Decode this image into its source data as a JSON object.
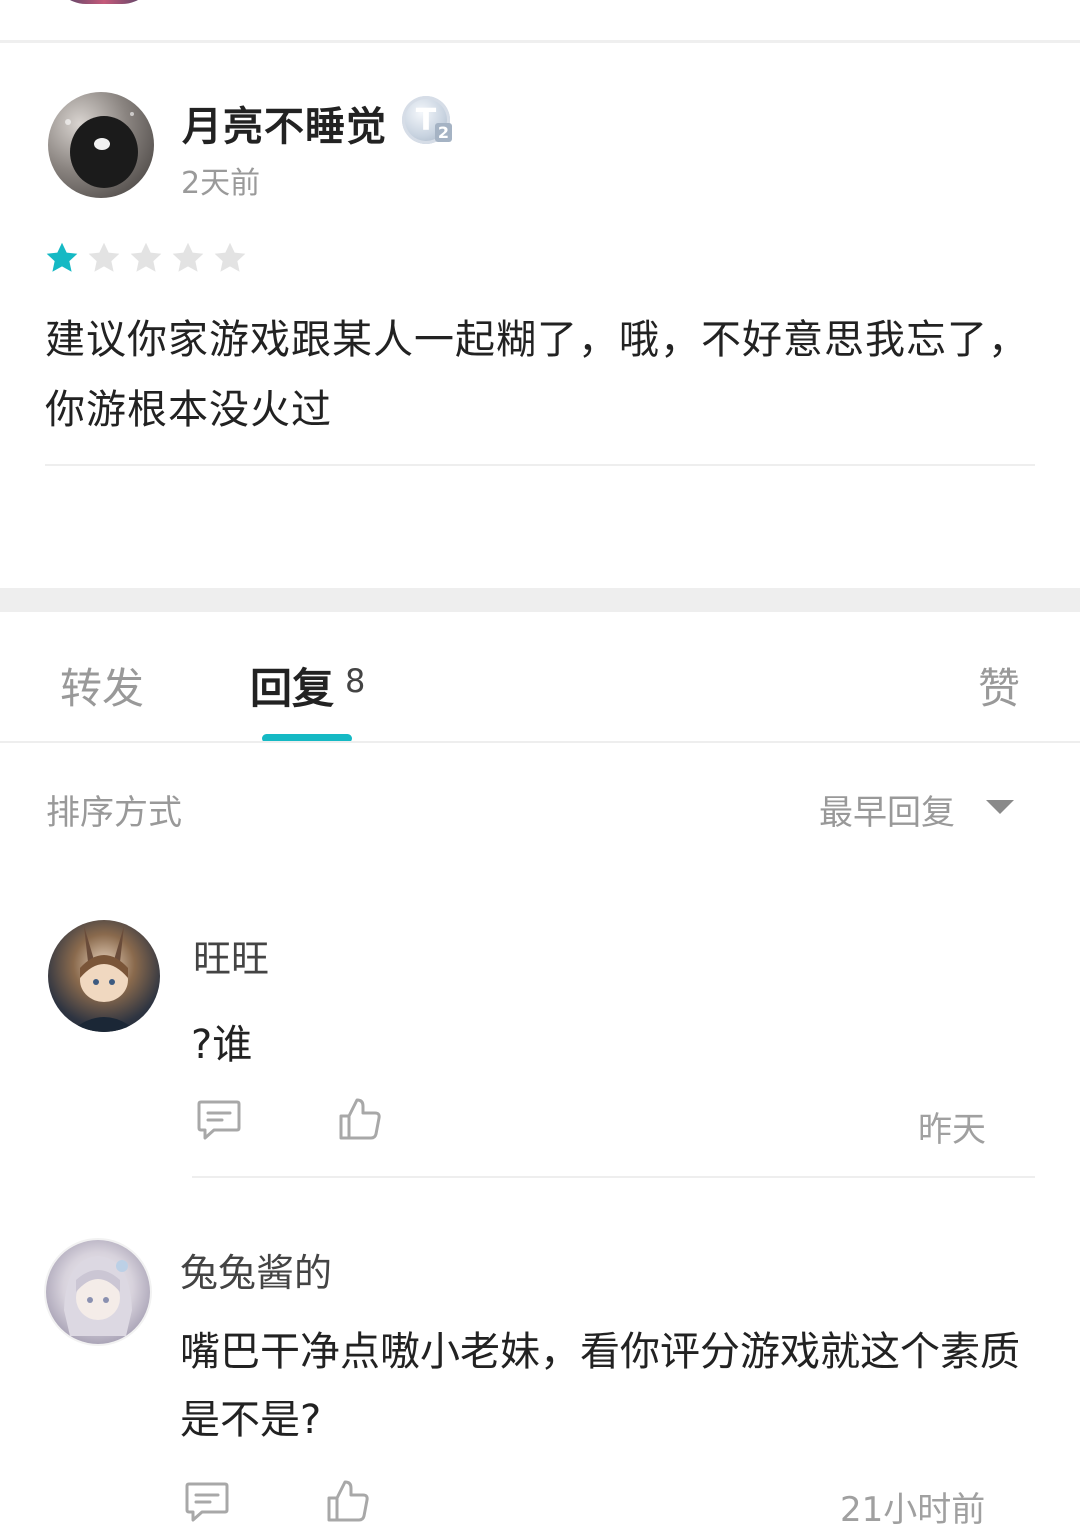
{
  "post": {
    "author_name": "月亮不睡觉",
    "level_badge": "T",
    "level_num": "2",
    "time": "2天前",
    "rating": 1,
    "rating_max": 5,
    "body": "建议你家游戏跟某人一起糊了，哦，不好意思我忘了，你游根本没火过"
  },
  "tabs": {
    "forward_label": "转发",
    "reply_label": "回复",
    "reply_count": "8",
    "like_label": "赞"
  },
  "sort": {
    "label": "排序方式",
    "selected": "最早回复"
  },
  "comments": [
    {
      "name": "旺旺",
      "body": "?谁",
      "time": "昨天"
    },
    {
      "name": "兔兔酱的",
      "body": "嘴巴干净点嗷小老妹，看你评分游戏就这个素质是不是?",
      "time": "21小时前"
    }
  ],
  "colors": {
    "accent": "#15b9c4",
    "muted_text": "#999999",
    "star_off": "#e3e3e3"
  }
}
